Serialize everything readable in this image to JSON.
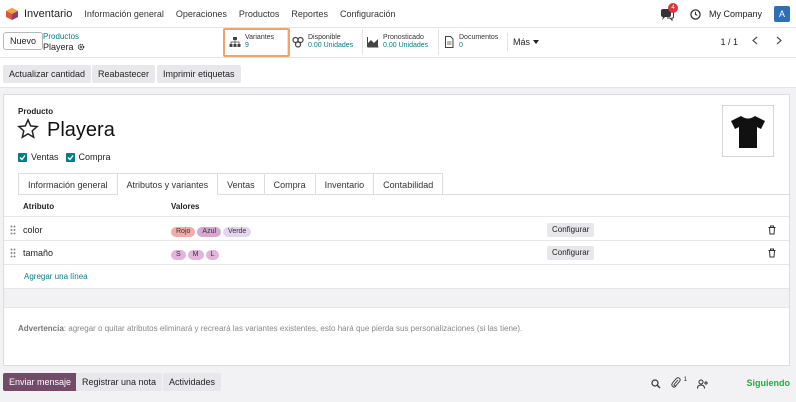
{
  "navbar": {
    "app_name": "Inventario",
    "menu": [
      "Información general",
      "Operaciones",
      "Productos",
      "Reportes",
      "Configuración"
    ],
    "chat_badge": "4",
    "company": "My Company",
    "avatar_letter": "A"
  },
  "control": {
    "new_label": "Nuevo",
    "breadcrumb_parent": "Productos",
    "breadcrumb_current": "Playera",
    "smart_buttons": [
      {
        "label": "Variantes",
        "value": "9",
        "icon": "sitemap-icon"
      },
      {
        "label": "Disponible",
        "value": "0.00 Unidades",
        "icon": "cubes-icon"
      },
      {
        "label": "Pronosticado",
        "value": "0.00 Unidades",
        "icon": "area-chart-icon"
      },
      {
        "label": "Documentos",
        "value": "0",
        "icon": "file-icon"
      }
    ],
    "more_label": "Más",
    "pager": "1 / 1"
  },
  "actions": [
    "Actualizar cantidad",
    "Reabastecer",
    "Imprimir etiquetas"
  ],
  "form": {
    "field_label": "Producto",
    "product_name": "Playera",
    "checks": [
      {
        "label": "Ventas",
        "checked": true
      },
      {
        "label": "Compra",
        "checked": true
      }
    ],
    "tabs": [
      "Información general",
      "Atributos y variantes",
      "Ventas",
      "Compra",
      "Inventario",
      "Contabilidad"
    ],
    "active_tab": "Atributos y variantes",
    "table": {
      "headers": [
        "Atributo",
        "Valores"
      ],
      "rows": [
        {
          "attribute": "color",
          "values": [
            {
              "label": "Rojo",
              "color": "#f5a9a9"
            },
            {
              "label": "Azul",
              "color": "#d7a8cf"
            },
            {
              "label": "Verde",
              "color": "#e5d4ef"
            }
          ],
          "button": "Configurar"
        },
        {
          "attribute": "tamaño",
          "values": [
            {
              "label": "S",
              "color": "#e2b4d9"
            },
            {
              "label": "M",
              "color": "#e2b4d9"
            },
            {
              "label": "L",
              "color": "#e2b4d9"
            }
          ],
          "button": "Configurar"
        }
      ],
      "add_line": "Agregar una línea"
    },
    "warning_label": "Advertencia",
    "warning_text": ": agregar o quitar atributos eliminará y recreará las variantes existentes, esto hará que pierda sus personalizaciones (si las tiene)."
  },
  "chatter": {
    "send_message": "Enviar mensaje",
    "log_note": "Registrar una nota",
    "activities": "Actividades",
    "attachments_count": "1",
    "following": "Siguiendo"
  },
  "colors": {
    "accent": "#017e84",
    "primary": "#714b67",
    "highlight": "#f0a46b",
    "following": "#28a745"
  }
}
